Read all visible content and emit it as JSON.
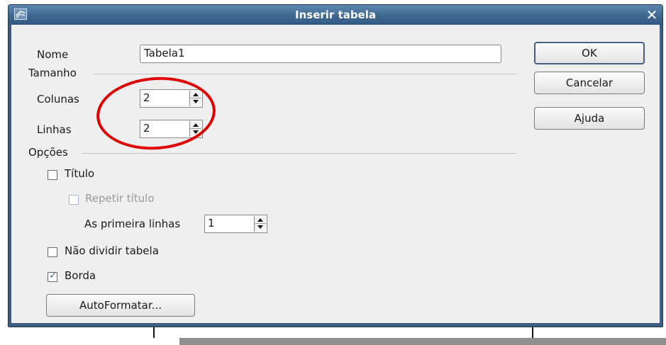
{
  "dialog": {
    "title": "Inserir tabela",
    "app_icon": "window-menu-icon",
    "close_icon": "close-icon",
    "close_glyph": "✕"
  },
  "name_field": {
    "label": "Nome",
    "value": "Tabela1"
  },
  "size_section": {
    "heading": "Tamanho",
    "columns": {
      "label": "Colunas",
      "value": "2"
    },
    "rows": {
      "label": "Linhas",
      "value": "2"
    }
  },
  "options_section": {
    "heading": "Opções",
    "title_checkbox": {
      "label": "Título",
      "checked": false
    },
    "repeat_title_checkbox": {
      "label": "Repetir título",
      "checked": false,
      "enabled": false
    },
    "first_rows": {
      "label": "As primeira linhas",
      "value": "1"
    },
    "dont_split_checkbox": {
      "label": "Não dividir tabela",
      "checked": false
    },
    "border_checkbox": {
      "label": "Borda",
      "checked": true,
      "tick": "✓"
    },
    "autoformat_button": "AutoFormatar..."
  },
  "buttons": {
    "ok": "OK",
    "cancel": "Cancelar",
    "help": "Ajuda"
  },
  "colors": {
    "annotation": "#e00000",
    "titlebar": "#3f6790"
  }
}
